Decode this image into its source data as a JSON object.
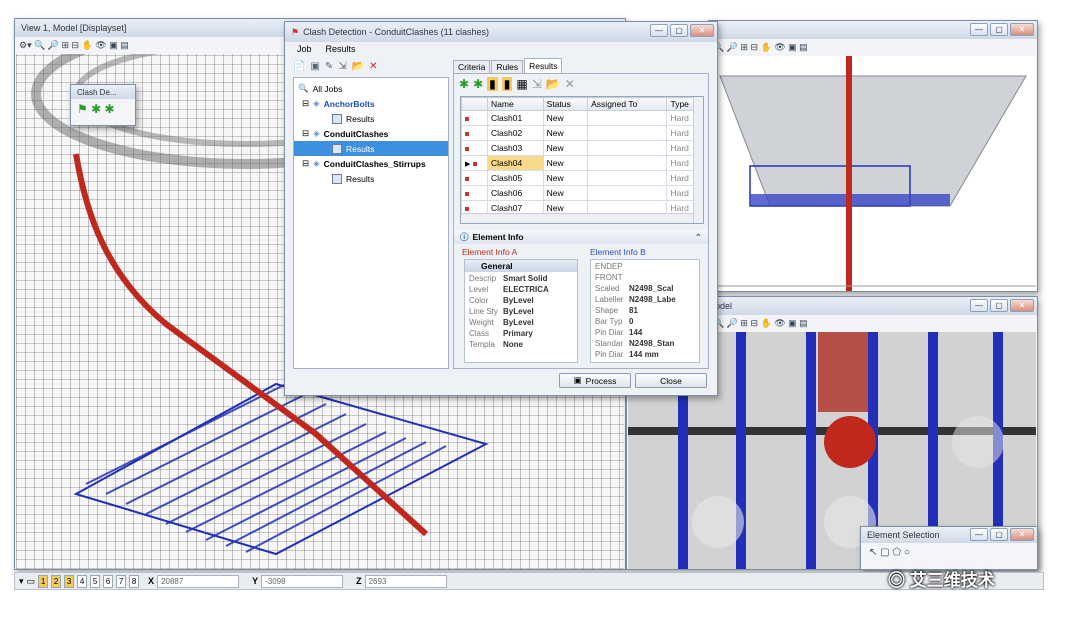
{
  "left_view": {
    "title": "View 1, Model [Displayset]"
  },
  "right_top_view": {
    "title": ""
  },
  "right_bottom_view": {
    "title": "odel"
  },
  "clash_toolbox": {
    "title": "Clash De..."
  },
  "dialog": {
    "title": "Clash Detection - ConduitClashes (11 clashes)",
    "menu": [
      "Job",
      "Results"
    ],
    "tree": {
      "root": "All Jobs",
      "jobs": [
        {
          "name": "AnchorBolts",
          "child": "Results"
        },
        {
          "name": "ConduitClashes",
          "child": "Results"
        },
        {
          "name": "ConduitClashes_Stirrups",
          "child": "Results"
        }
      ]
    },
    "tabs": [
      "Criteria",
      "Rules",
      "Results"
    ],
    "columns": [
      "Name",
      "Status",
      "Assigned To",
      "Type"
    ],
    "rows": [
      {
        "name": "Clash01",
        "status": "New",
        "assigned": "",
        "type": "Hard"
      },
      {
        "name": "Clash02",
        "status": "New",
        "assigned": "",
        "type": "Hard"
      },
      {
        "name": "Clash03",
        "status": "New",
        "assigned": "",
        "type": "Hard"
      },
      {
        "name": "Clash04",
        "status": "New",
        "assigned": "",
        "type": "Hard"
      },
      {
        "name": "Clash05",
        "status": "New",
        "assigned": "",
        "type": "Hard"
      },
      {
        "name": "Clash06",
        "status": "New",
        "assigned": "",
        "type": "Hard"
      },
      {
        "name": "Clash07",
        "status": "New",
        "assigned": "",
        "type": "Hard"
      }
    ],
    "element_info": {
      "header": "Element Info",
      "a_label": "Element Info A",
      "b_label": "Element Info B",
      "general": "General",
      "a_props": [
        {
          "k": "Descrip",
          "v": "Smart Solid"
        },
        {
          "k": "Level",
          "v": "ELECTRICA"
        },
        {
          "k": "Color",
          "v": "ByLevel"
        },
        {
          "k": "Line Sty",
          "v": "ByLevel"
        },
        {
          "k": "Weight",
          "v": "ByLevel"
        },
        {
          "k": "Class",
          "v": "Primary"
        },
        {
          "k": "Templa",
          "v": "None"
        }
      ],
      "b_props": [
        {
          "k": "ENDEP",
          "v": ""
        },
        {
          "k": "FRONT",
          "v": ""
        },
        {
          "k": "Scaled",
          "v": "N2498_Scal"
        },
        {
          "k": "Labeller",
          "v": "N2498_Labe"
        },
        {
          "k": "Shape",
          "v": "81"
        },
        {
          "k": "Bar Typ",
          "v": "0"
        },
        {
          "k": "Pin Diar",
          "v": "144"
        },
        {
          "k": "Standar",
          "v": "N2498_Stan"
        },
        {
          "k": "Pin Diar",
          "v": "144 mm"
        }
      ]
    },
    "process_label": "Process",
    "close_label": "Close"
  },
  "element_selection": {
    "title": "Element Selection"
  },
  "statusbar": {
    "levels": [
      "1",
      "2",
      "3",
      "4",
      "5",
      "6",
      "7",
      "8"
    ],
    "x_label": "X",
    "x_value": "20887",
    "y_label": "Y",
    "y_value": "-3098",
    "z_label": "Z",
    "z_value": "2693"
  },
  "watermark": "艾三维技术",
  "colors": {
    "clash_red": "#c0281e",
    "rebar_blue": "#2230b8",
    "selection": "#3d8fe0"
  }
}
